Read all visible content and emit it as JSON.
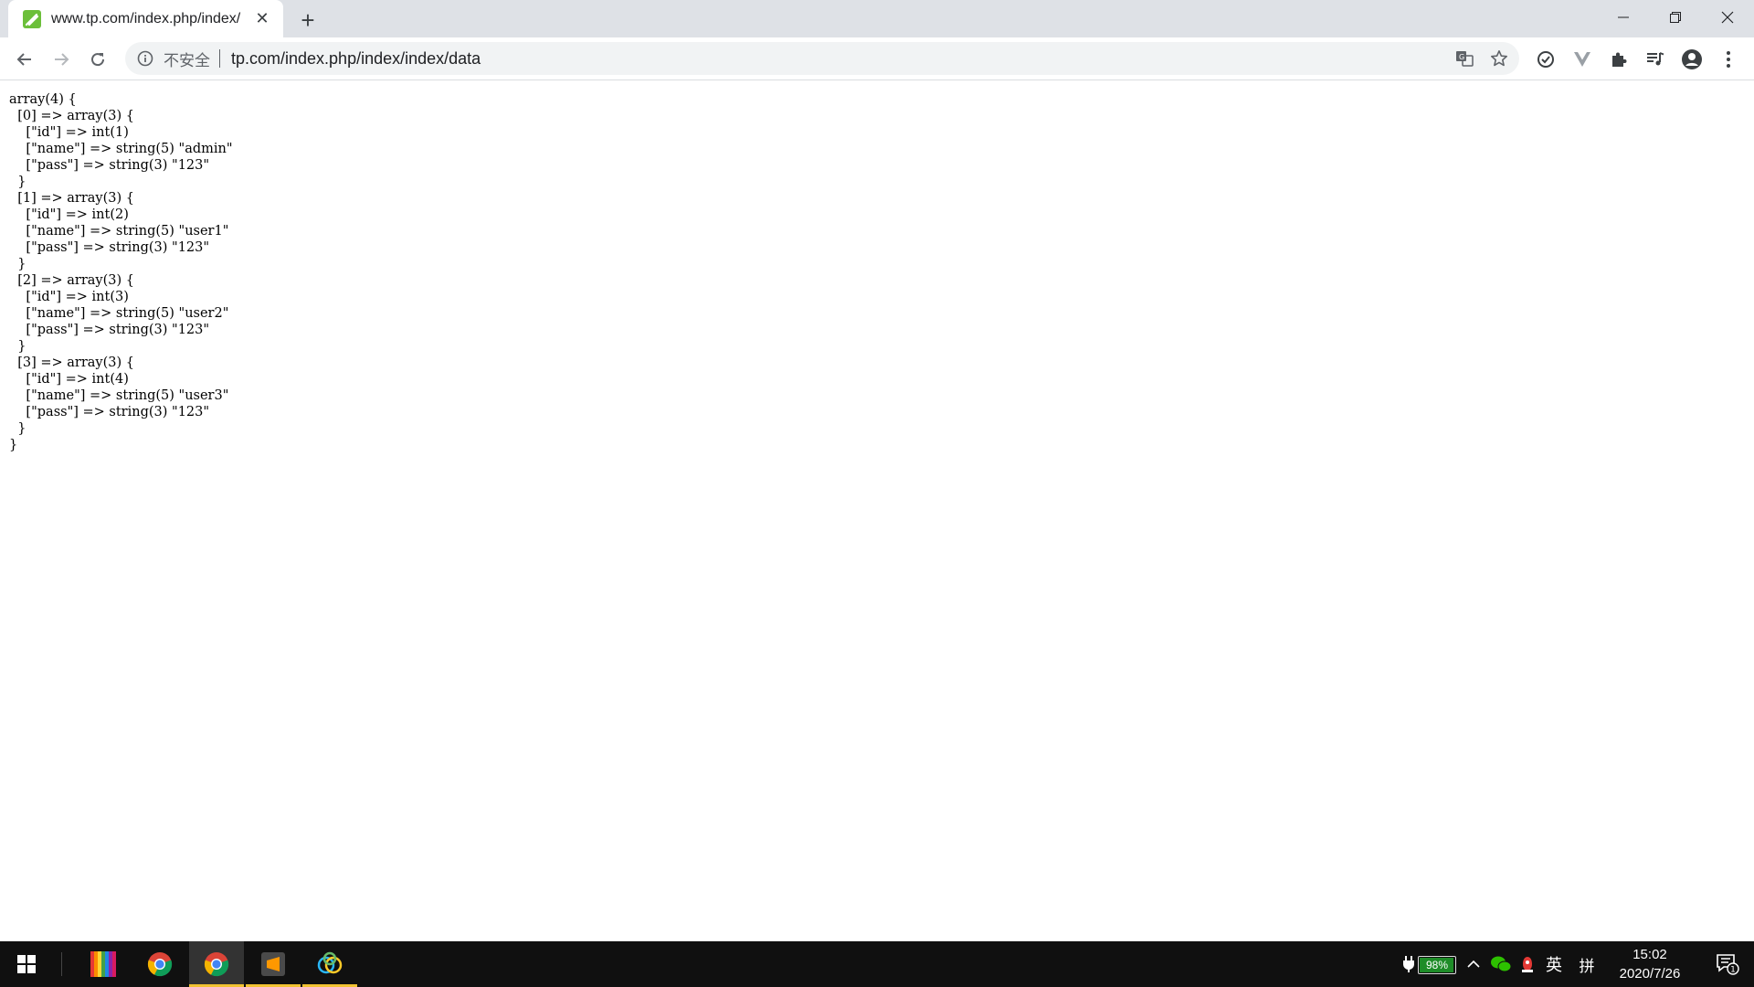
{
  "window": {
    "tab_title": "www.tp.com/index.php/index/",
    "tab_close_glyph": "✕",
    "new_tab_glyph": "+"
  },
  "toolbar": {
    "security_label": "不安全",
    "url": "tp.com/index.php/index/index/data"
  },
  "page": {
    "dump_lines": [
      "array(4) {",
      "  [0] => array(3) {",
      "    [\"id\"] => int(1)",
      "    [\"name\"] => string(5) \"admin\"",
      "    [\"pass\"] => string(3) \"123\"",
      "  }",
      "  [1] => array(3) {",
      "    [\"id\"] => int(2)",
      "    [\"name\"] => string(5) \"user1\"",
      "    [\"pass\"] => string(3) \"123\"",
      "  }",
      "  [2] => array(3) {",
      "    [\"id\"] => int(3)",
      "    [\"name\"] => string(5) \"user2\"",
      "    [\"pass\"] => string(3) \"123\"",
      "  }",
      "  [3] => array(3) {",
      "    [\"id\"] => int(4)",
      "    [\"name\"] => string(5) \"user3\"",
      "    [\"pass\"] => string(3) \"123\"",
      "  }",
      "}"
    ]
  },
  "taskbar": {
    "battery_percent": "98%",
    "battery_level": 0.98,
    "ime_label": "英",
    "ime_mode_label": "拼",
    "time": "15:02",
    "date": "2020/7/26",
    "notification_count": "1"
  },
  "colors": {
    "tab_bar_bg": "#dee1e6",
    "omnibox_bg": "#f1f3f4",
    "taskbar_bg": "#101010",
    "active_app_indicator": "#f1c232",
    "battery_fill": "#1e8c28"
  }
}
